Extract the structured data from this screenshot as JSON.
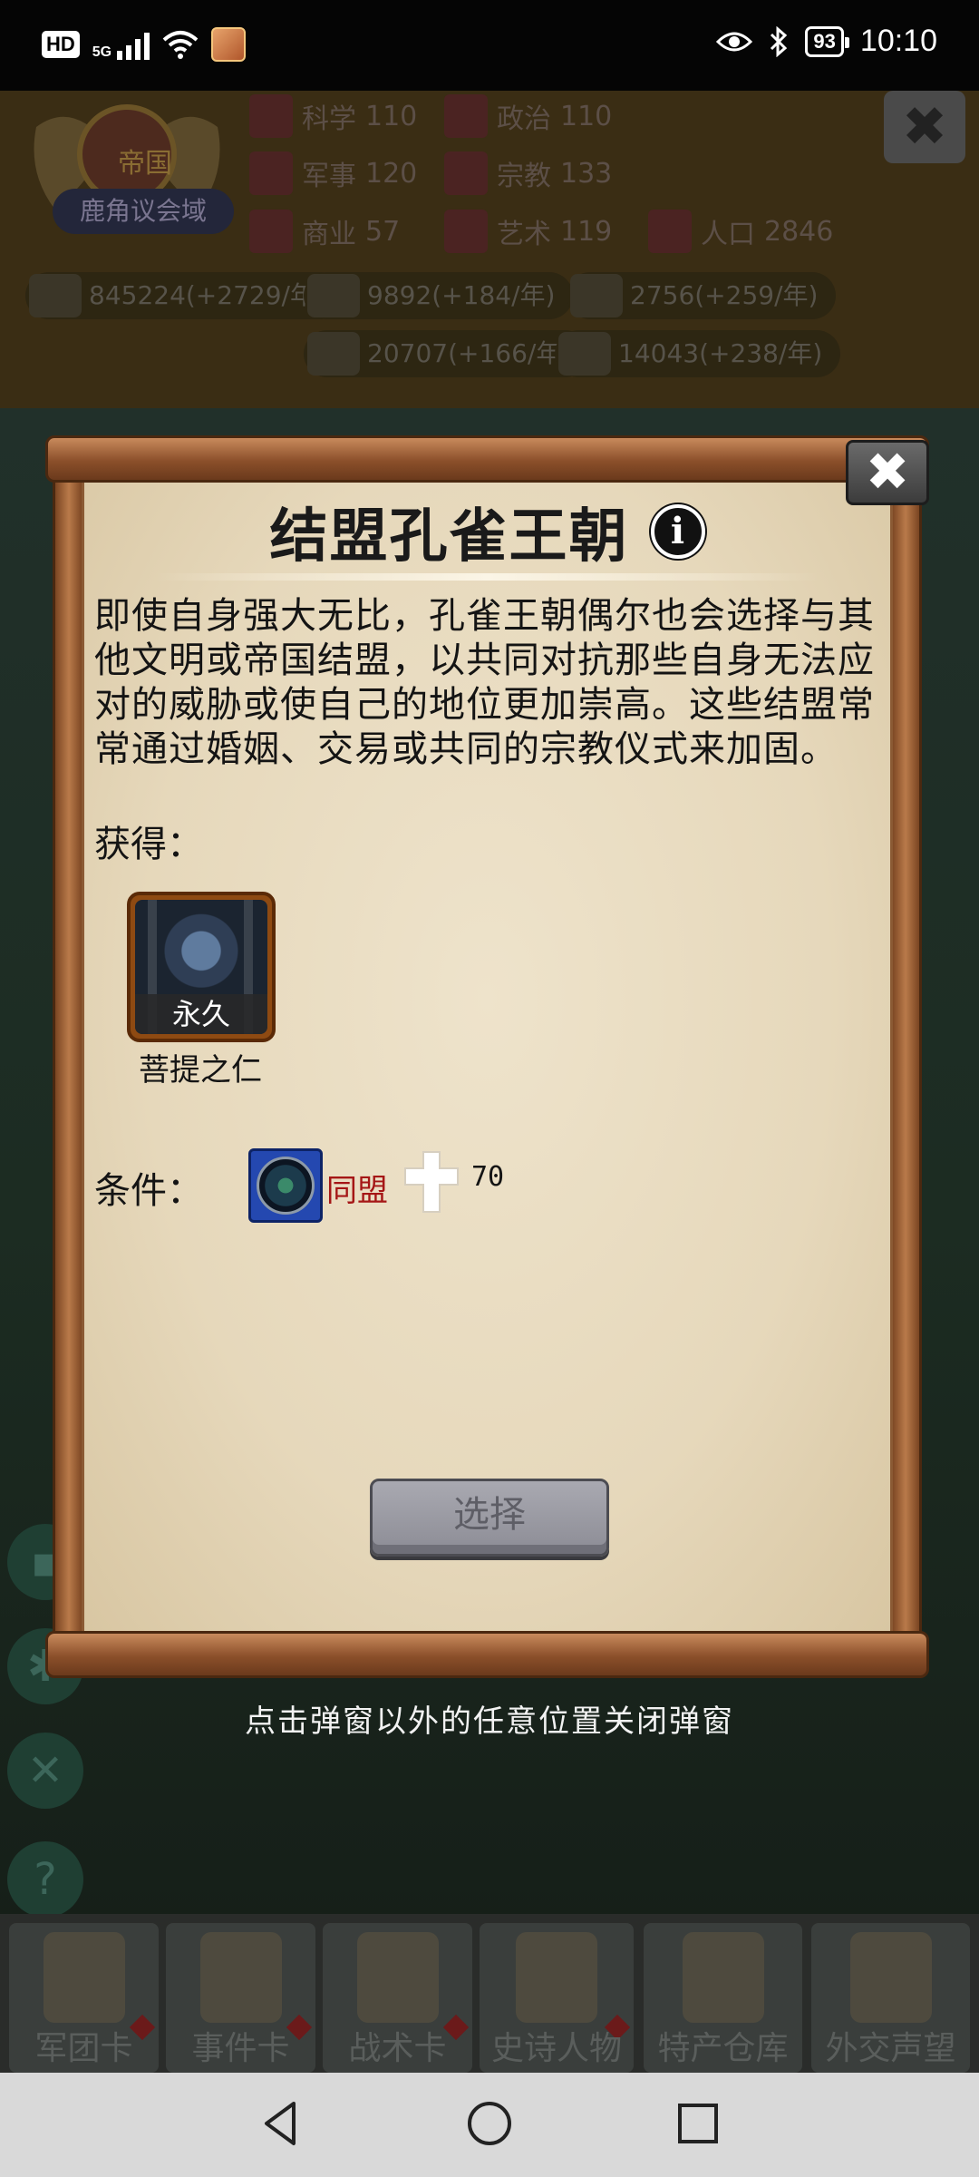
{
  "status_bar": {
    "hd_label": "HD",
    "network_label": "5G",
    "battery": "93",
    "time": "10:10"
  },
  "background": {
    "emblem_title": "帝国",
    "emblem_subtitle": "鹿角议会域",
    "stats": [
      {
        "label": "科学",
        "value": "110"
      },
      {
        "label": "政治",
        "value": "110"
      },
      {
        "label": "军事",
        "value": "120"
      },
      {
        "label": "宗教",
        "value": "133"
      },
      {
        "label": "商业",
        "value": "57"
      },
      {
        "label": "艺术",
        "value": "119"
      },
      {
        "label": "人口",
        "value": "2846"
      }
    ],
    "resources": [
      "845224(+2729/年)",
      "9892(+184/年)",
      "2756(+259/年)",
      "20707(+166/年)",
      "14043(+238/年)"
    ],
    "tabs": [
      "军团卡",
      "事件卡",
      "战术卡",
      "史诗人物",
      "特产仓库",
      "外交声望"
    ],
    "side_buttons": [
      "chat-icon",
      "gear-icon",
      "mute-icon",
      "help-icon"
    ]
  },
  "modal": {
    "title": "结盟孔雀王朝",
    "description": "即使自身强大无比，孔雀王朝偶尔也会选择与其他文明或帝国结盟，以共同对抗那些自身无法应对的威胁或使自己的地位更加崇高。这些结盟常常通过婚姻、交易或共同的宗教仪式来加固。",
    "reward_label": "获得：",
    "reward": {
      "tag": "永久",
      "name": "菩提之仁"
    },
    "condition_label": "条件：",
    "condition": {
      "alliance_text": "同盟",
      "value": "70"
    },
    "select_label": "选择"
  },
  "hint": "点击弹窗以外的任意位置关闭弹窗",
  "colors": {
    "paper": "#e6d8bb",
    "scroll_wood": "#8b4f2a",
    "condition_text": "#a51616",
    "button_disabled": "#9a9aa2"
  }
}
